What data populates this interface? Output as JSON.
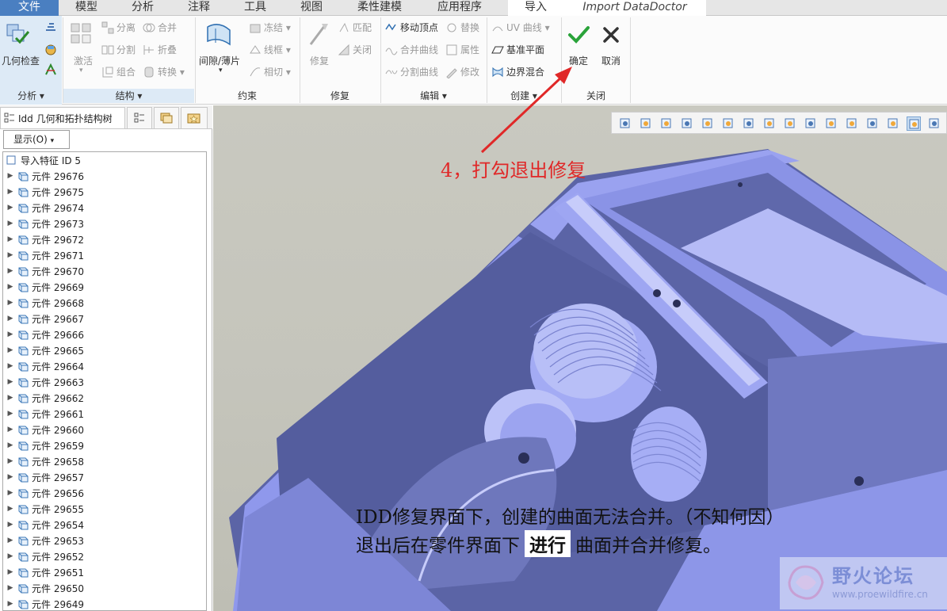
{
  "tabs": [
    {
      "label": "文件"
    },
    {
      "label": "模型"
    },
    {
      "label": "分析"
    },
    {
      "label": "注释"
    },
    {
      "label": "工具"
    },
    {
      "label": "视图"
    },
    {
      "label": "柔性建模"
    },
    {
      "label": "应用程序"
    },
    {
      "label": "导入"
    },
    {
      "label": "Import DataDoctor"
    }
  ],
  "ribbon": {
    "analysis": {
      "geom_check": "几何检查",
      "group": "分析"
    },
    "structure": {
      "activate": "激活",
      "separate": "分离",
      "merge": "合并",
      "split": "分割",
      "fold": "折叠",
      "combine": "组合",
      "convert": "转换",
      "group": "结构"
    },
    "constraint": {
      "gap_sheet": "间隙/薄片",
      "freeze": "冻结",
      "wireframe": "线框",
      "tangent": "相切",
      "group": "约束"
    },
    "repair": {
      "repair": "修复",
      "match": "匹配",
      "close": "关闭",
      "group": "修复"
    },
    "edit": {
      "move_vertex": "移动顶点",
      "replace": "替换",
      "merge_curve": "合并曲线",
      "attribute": "属性",
      "split_curve": "分割曲线",
      "modify": "修改",
      "group": "编辑"
    },
    "create": {
      "uv_curve": "UV 曲线",
      "datum_plane": "基准平面",
      "boundary_blend": "边界混合",
      "group": "创建"
    },
    "close": {
      "ok": "确定",
      "cancel": "取消",
      "group": "关闭"
    }
  },
  "left_panel": {
    "tab_title": "Idd 几何和拓扑结构树",
    "show_label": "显示(O)",
    "root": "导入特征 ID 5",
    "items": [
      "元件 29676",
      "元件 29675",
      "元件 29674",
      "元件 29673",
      "元件 29672",
      "元件 29671",
      "元件 29670",
      "元件 29669",
      "元件 29668",
      "元件 29667",
      "元件 29666",
      "元件 29665",
      "元件 29664",
      "元件 29663",
      "元件 29662",
      "元件 29661",
      "元件 29660",
      "元件 29659",
      "元件 29658",
      "元件 29657",
      "元件 29656",
      "元件 29655",
      "元件 29654",
      "元件 29653",
      "元件 29652",
      "元件 29651",
      "元件 29650",
      "元件 29649"
    ]
  },
  "annotations": {
    "step4": "4，打勾退出修复",
    "note_line1": "IDD修复界面下，创建的曲面无法合并。（不知何因）",
    "note_line2_a": "退出后在零件界面下",
    "note_line2_b": "进行",
    "note_line2_c": "曲面并合并修复。"
  },
  "watermark": {
    "name": "野火论坛",
    "url": "www.proewildfire.cn"
  },
  "colors": {
    "accent": "#4a7fc1",
    "model": "#8d95ea",
    "model_dark": "#5a63a5",
    "annotation_red": "#e02828",
    "ok_green": "#2aa33a"
  }
}
